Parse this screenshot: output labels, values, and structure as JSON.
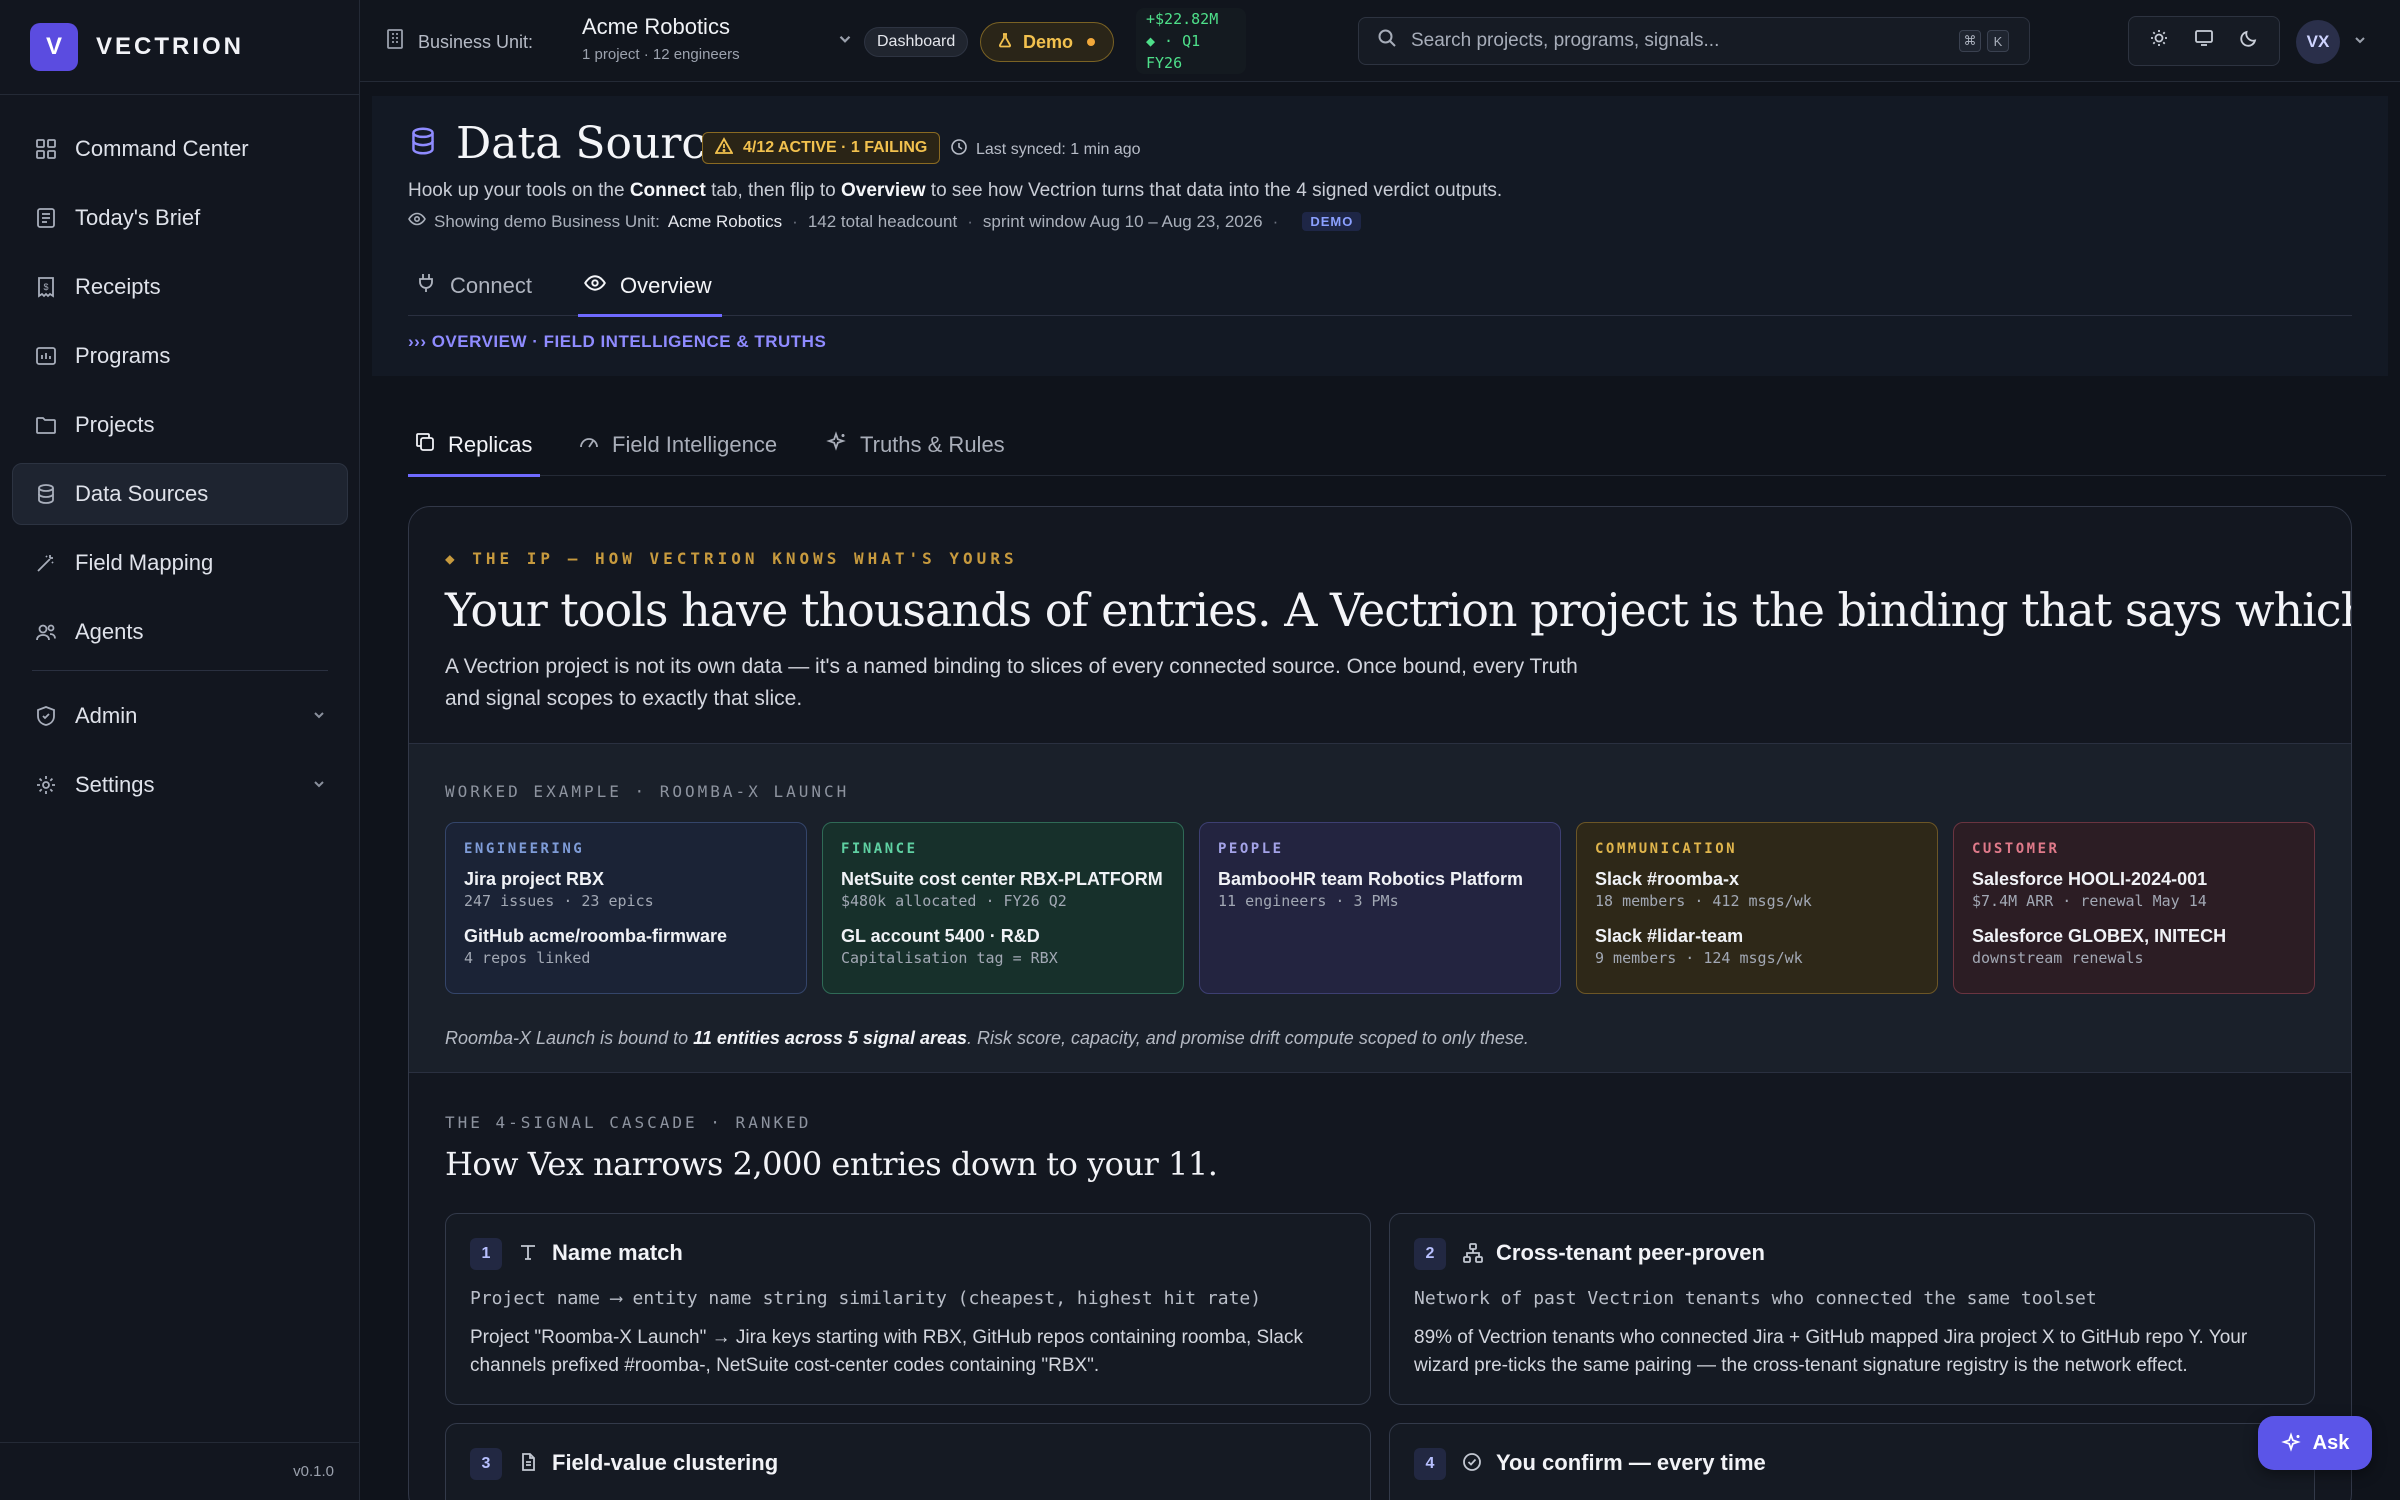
{
  "brand": {
    "logo_letter": "V",
    "name": "VECTRION"
  },
  "sidebar": {
    "items": [
      {
        "label": "Command Center",
        "icon": "grid-icon"
      },
      {
        "label": "Today's Brief",
        "icon": "newspaper-icon"
      },
      {
        "label": "Receipts",
        "icon": "receipt-icon"
      },
      {
        "label": "Programs",
        "icon": "chart-board-icon"
      },
      {
        "label": "Projects",
        "icon": "folder-icon"
      },
      {
        "label": "Data Sources",
        "icon": "database-icon",
        "active": true
      },
      {
        "label": "Field Mapping",
        "icon": "wand-icon"
      },
      {
        "label": "Agents",
        "icon": "users-icon"
      }
    ],
    "groups": [
      {
        "label": "Admin",
        "icon": "shield-icon"
      },
      {
        "label": "Settings",
        "icon": "gear-icon"
      }
    ],
    "version": "v0.1.0"
  },
  "topbar": {
    "bu_label": "Business Unit:",
    "bu_name": "Acme Robotics",
    "bu_sub": "1 project · 12 engineers",
    "dashboard_pill": "Dashboard",
    "demo_pill": "Demo",
    "ticker_line1": "+$22.82M",
    "ticker_line2": "◆ · Q1",
    "ticker_line3": "FY26",
    "search_placeholder": "Search projects, programs, signals...",
    "kbd_cmd": "⌘",
    "kbd_k": "K",
    "avatar": "VX"
  },
  "header": {
    "title": "Data Sources",
    "status_badge": "4/12 ACTIVE · 1 FAILING",
    "last_synced": "Last synced: 1 min ago",
    "desc_pre": "Hook up your tools on the ",
    "desc_connect": "Connect",
    "desc_mid": " tab, then flip to ",
    "desc_overview": "Overview",
    "desc_post": " to see how Vectrion turns that data into the 4 signed verdict outputs.",
    "meta_showing": "Showing demo Business Unit:",
    "meta_bu": "Acme Robotics",
    "meta_headcount": "142 total headcount",
    "meta_sprint": "sprint window Aug 10 – Aug 23, 2026",
    "meta_tag": "DEMO",
    "tabs": [
      {
        "label": "Connect",
        "icon": "plug-icon"
      },
      {
        "label": "Overview",
        "icon": "eye-icon",
        "active": true
      }
    ],
    "breadcrumb": "››› OVERVIEW · FIELD INTELLIGENCE & TRUTHS"
  },
  "subtabs": [
    {
      "label": "Replicas",
      "icon": "copy-icon",
      "active": true
    },
    {
      "label": "Field Intelligence",
      "icon": "gauge-icon"
    },
    {
      "label": "Truths & Rules",
      "icon": "sparkle-icon"
    }
  ],
  "ip": {
    "eyebrow": "◆ THE IP — HOW VECTRION KNOWS WHAT'S YOURS",
    "headline": "Your tools have thousands of entries. A Vectrion project is the binding that says which ones are this program.",
    "lead": "A Vectrion project is not its own data — it's a named binding to slices of every connected source. Once bound, every Truth and signal scopes to exactly that slice."
  },
  "worked": {
    "label": "WORKED EXAMPLE · ROOMBA-X LAUNCH",
    "cards": [
      {
        "category": "ENGINEERING",
        "items": [
          {
            "title": "Jira project RBX",
            "sub": "247 issues · 23 epics"
          },
          {
            "title": "GitHub acme/roomba-firmware",
            "sub": "4 repos linked"
          }
        ]
      },
      {
        "category": "FINANCE",
        "items": [
          {
            "title": "NetSuite cost center RBX-PLATFORM",
            "sub": "$480k allocated · FY26 Q2"
          },
          {
            "title": "GL account 5400 · R&D",
            "sub": "Capitalisation tag = RBX"
          }
        ]
      },
      {
        "category": "PEOPLE",
        "items": [
          {
            "title": "BambooHR team Robotics Platform",
            "sub": "11 engineers · 3 PMs"
          }
        ]
      },
      {
        "category": "COMMUNICATION",
        "items": [
          {
            "title": "Slack #roomba-x",
            "sub": "18 members · 412 msgs/wk"
          },
          {
            "title": "Slack #lidar-team",
            "sub": "9 members · 124 msgs/wk"
          }
        ]
      },
      {
        "category": "CUSTOMER",
        "items": [
          {
            "title": "Salesforce HOOLI-2024-001",
            "sub": "$7.4M ARR · renewal May 14"
          },
          {
            "title": "Salesforce GLOBEX, INITECH",
            "sub": "downstream renewals"
          }
        ]
      }
    ],
    "bound_pre": "Roomba-X Launch is bound to ",
    "bound_strong": "11 entities across 5 signal areas",
    "bound_post": ". Risk score, capacity, and promise drift compute scoped to only these."
  },
  "cascade": {
    "label": "THE 4-SIGNAL CASCADE · RANKED",
    "title": "How Vex narrows 2,000 entries down to your 11.",
    "steps": [
      {
        "num": "1",
        "title": "Name match",
        "mono": "Project name ⟶ entity name string similarity (cheapest, highest hit rate)",
        "body": "Project \"Roomba-X Launch\" → Jira keys starting with RBX, GitHub repos containing roomba, Slack channels prefixed #roomba-, NetSuite cost-center codes containing \"RBX\"."
      },
      {
        "num": "2",
        "title": "Cross-tenant peer-proven",
        "mono": "Network of past Vectrion tenants who connected the same toolset",
        "body": "89% of Vectrion tenants who connected Jira + GitHub mapped Jira project X to GitHub repo Y. Your wizard pre-ticks the same pairing — the cross-tenant signature registry is the network effect."
      },
      {
        "num": "3",
        "title": "Field-value clustering"
      },
      {
        "num": "4",
        "title": "You confirm — every time"
      }
    ]
  },
  "ask_label": "Ask"
}
